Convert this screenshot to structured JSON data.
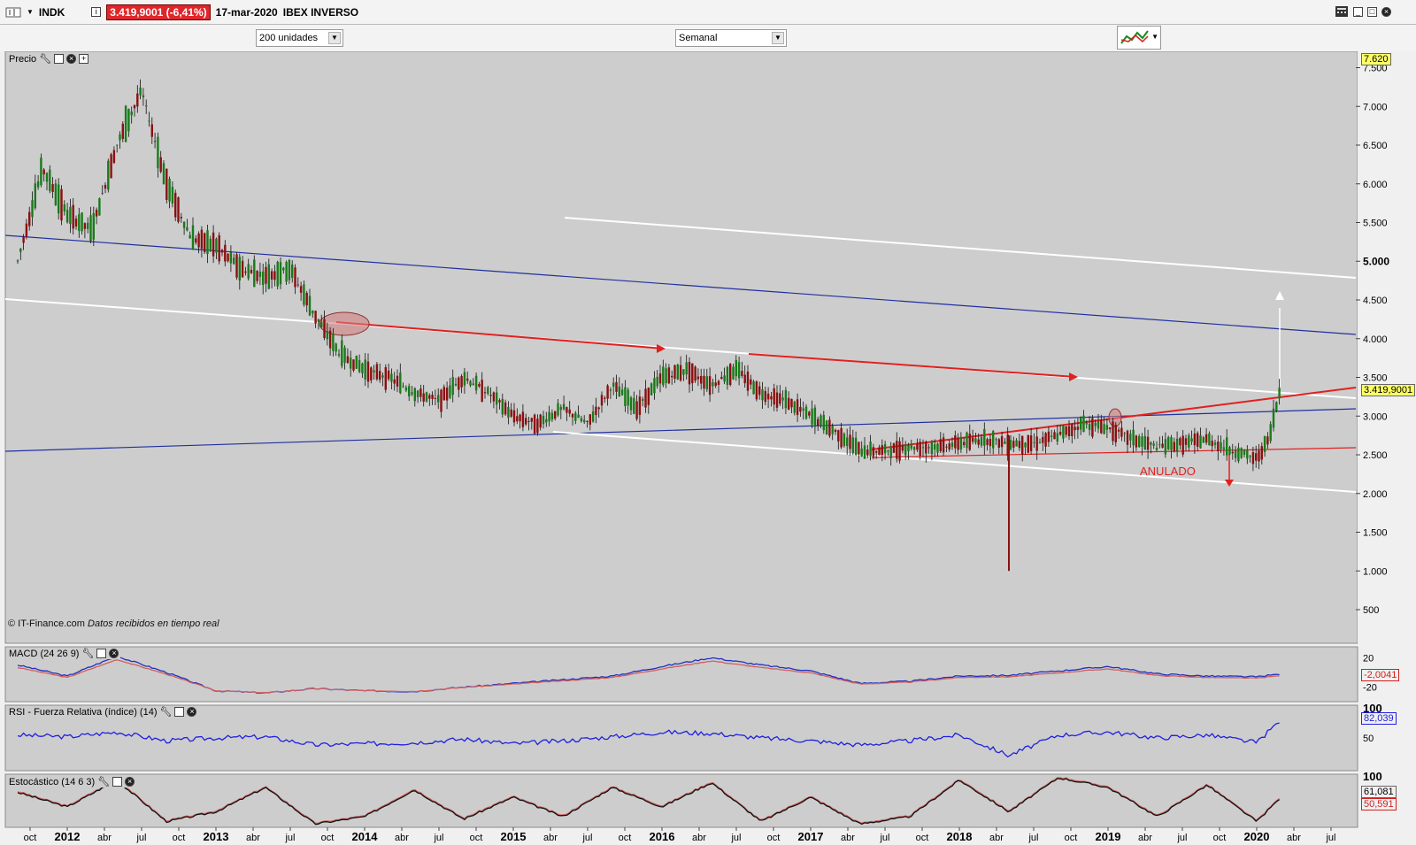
{
  "header": {
    "symbol": "INDK",
    "price_change": "3.419,9001 (-6,41%)",
    "date": "17-mar-2020",
    "instrument_name": "IBEX INVERSO"
  },
  "toolbar": {
    "units_select": "200 unidades",
    "period_select": "Semanal"
  },
  "panels": {
    "price": {
      "label": "Precio",
      "last_value": "3.419,9001",
      "top_value": "7.620"
    },
    "macd": {
      "label": "MACD (24 26 9)",
      "last_value": "-2,0041"
    },
    "rsi": {
      "label": "RSI - Fuerza Relativa (índice) (14)",
      "last_value": "82,039"
    },
    "stoch": {
      "label": "Estocástico (14 6 3)",
      "last_value_k": "61,081",
      "last_value_d": "50,591"
    }
  },
  "copyright": {
    "brand": "© IT-Finance.com",
    "note": "Datos recibidos en tiempo real"
  },
  "annotation_text": "ANULADO",
  "colors": {
    "up_candle": "#1a7a1a",
    "down_candle": "#8a1010",
    "red_line": "#e02020",
    "blue_line": "#2030a0",
    "white_line": "#ffffff",
    "rsi_line": "#2020e0",
    "chart_bg": "#cdcdcd"
  },
  "chart_data": [
    {
      "type": "line",
      "panel": "price",
      "series": [
        {
          "x": [
            "2011-09",
            "2011-11",
            "2012-01",
            "2012-03",
            "2012-05",
            "2012-07",
            "2012-09",
            "2012-11",
            "2013-01",
            "2013-03",
            "2013-05",
            "2013-07",
            "2013-09",
            "2013-11",
            "2014-01",
            "2014-03",
            "2014-05",
            "2014-07",
            "2014-09",
            "2014-11",
            "2015-01",
            "2015-03",
            "2015-05",
            "2015-07",
            "2015-09",
            "2015-11",
            "2016-01",
            "2016-03",
            "2016-05",
            "2016-07",
            "2016-09",
            "2016-11",
            "2017-01",
            "2017-03",
            "2017-05",
            "2017-07",
            "2017-09",
            "2017-11",
            "2018-01",
            "2018-03",
            "2018-05",
            "2018-07",
            "2018-09",
            "2018-11",
            "2019-01",
            "2019-03",
            "2019-05",
            "2019-07",
            "2019-09",
            "2019-11",
            "2020-01",
            "2020-02",
            "2020-03"
          ],
          "y": [
            5.0,
            6.2,
            5.6,
            5.4,
            6.5,
            7.2,
            6.0,
            5.3,
            5.2,
            4.9,
            4.8,
            4.9,
            4.3,
            3.8,
            3.6,
            3.5,
            3.3,
            3.2,
            3.5,
            3.3,
            3.0,
            2.9,
            3.1,
            2.9,
            3.4,
            3.1,
            3.5,
            3.6,
            3.4,
            3.6,
            3.3,
            3.2,
            3.0,
            2.8,
            2.55,
            2.55,
            2.6,
            2.6,
            2.65,
            2.7,
            2.65,
            2.65,
            2.75,
            2.9,
            2.85,
            2.7,
            2.6,
            2.65,
            2.7,
            2.55,
            2.45,
            2.7,
            3.42
          ]
        }
      ],
      "ylim": [
        500,
        7620
      ],
      "y_ticks": [
        "500",
        "1.000",
        "1.500",
        "2.000",
        "2.500",
        "3.000",
        "3.500",
        "4.000",
        "4.500",
        "5.000",
        "5.500",
        "6.000",
        "6.500",
        "7.000",
        "7.500"
      ],
      "x_ticks": [
        "oct",
        "2012",
        "abr",
        "jul",
        "oct",
        "2013",
        "abr",
        "jul",
        "oct",
        "2014",
        "abr",
        "jul",
        "oct",
        "2015",
        "abr",
        "jul",
        "oct",
        "2016",
        "abr",
        "jul",
        "oct",
        "2017",
        "abr",
        "jul",
        "oct",
        "2018",
        "abr",
        "jul",
        "oct",
        "2019",
        "abr",
        "jul",
        "oct",
        "2020",
        "abr",
        "jul"
      ]
    },
    {
      "type": "line",
      "panel": "macd",
      "y_ticks": [
        "20",
        "-20"
      ],
      "series": [
        {
          "x": [
            "2011-09",
            "2012-01",
            "2012-05",
            "2012-09",
            "2013-01",
            "2013-05",
            "2013-09",
            "2014-01",
            "2014-05",
            "2014-09",
            "2015-01",
            "2015-05",
            "2015-09",
            "2016-01",
            "2016-05",
            "2016-09",
            "2017-01",
            "2017-05",
            "2017-09",
            "2018-01",
            "2018-05",
            "2018-09",
            "2019-01",
            "2019-05",
            "2019-09",
            "2020-01",
            "2020-03"
          ],
          "y": [
            10,
            -5,
            22,
            0,
            -25,
            -28,
            -22,
            -25,
            -26,
            -20,
            -15,
            -10,
            -5,
            8,
            20,
            10,
            2,
            -15,
            -12,
            -5,
            -4,
            2,
            8,
            -2,
            -5,
            -6,
            -2
          ]
        }
      ]
    },
    {
      "type": "line",
      "panel": "rsi",
      "y_ticks": [
        "100",
        "50"
      ],
      "series": [
        {
          "x": [
            "2011-09",
            "2012-01",
            "2012-05",
            "2012-09",
            "2013-01",
            "2013-05",
            "2013-09",
            "2014-01",
            "2014-05",
            "2014-09",
            "2015-01",
            "2015-05",
            "2015-09",
            "2016-01",
            "2016-05",
            "2016-09",
            "2017-01",
            "2017-05",
            "2017-09",
            "2018-01",
            "2018-05",
            "2018-09",
            "2019-01",
            "2019-05",
            "2019-09",
            "2020-01",
            "2020-03"
          ],
          "y": [
            55,
            52,
            60,
            45,
            50,
            52,
            38,
            40,
            42,
            48,
            40,
            45,
            52,
            60,
            58,
            50,
            45,
            38,
            45,
            55,
            20,
            55,
            60,
            50,
            55,
            42,
            82
          ]
        }
      ]
    },
    {
      "type": "line",
      "panel": "stoch",
      "y_ticks": [
        "100"
      ],
      "series": [
        {
          "x": [
            "2011-09",
            "2012-01",
            "2012-05",
            "2012-09",
            "2013-01",
            "2013-05",
            "2013-09",
            "2014-01",
            "2014-05",
            "2014-09",
            "2015-01",
            "2015-05",
            "2015-09",
            "2016-01",
            "2016-05",
            "2016-09",
            "2017-01",
            "2017-05",
            "2017-09",
            "2018-01",
            "2018-05",
            "2018-09",
            "2019-01",
            "2019-05",
            "2019-09",
            "2020-01",
            "2020-03"
          ],
          "y": [
            70,
            40,
            95,
            10,
            30,
            80,
            5,
            20,
            75,
            15,
            60,
            20,
            80,
            40,
            90,
            10,
            60,
            5,
            20,
            95,
            30,
            100,
            80,
            20,
            85,
            10,
            61
          ]
        }
      ]
    }
  ]
}
